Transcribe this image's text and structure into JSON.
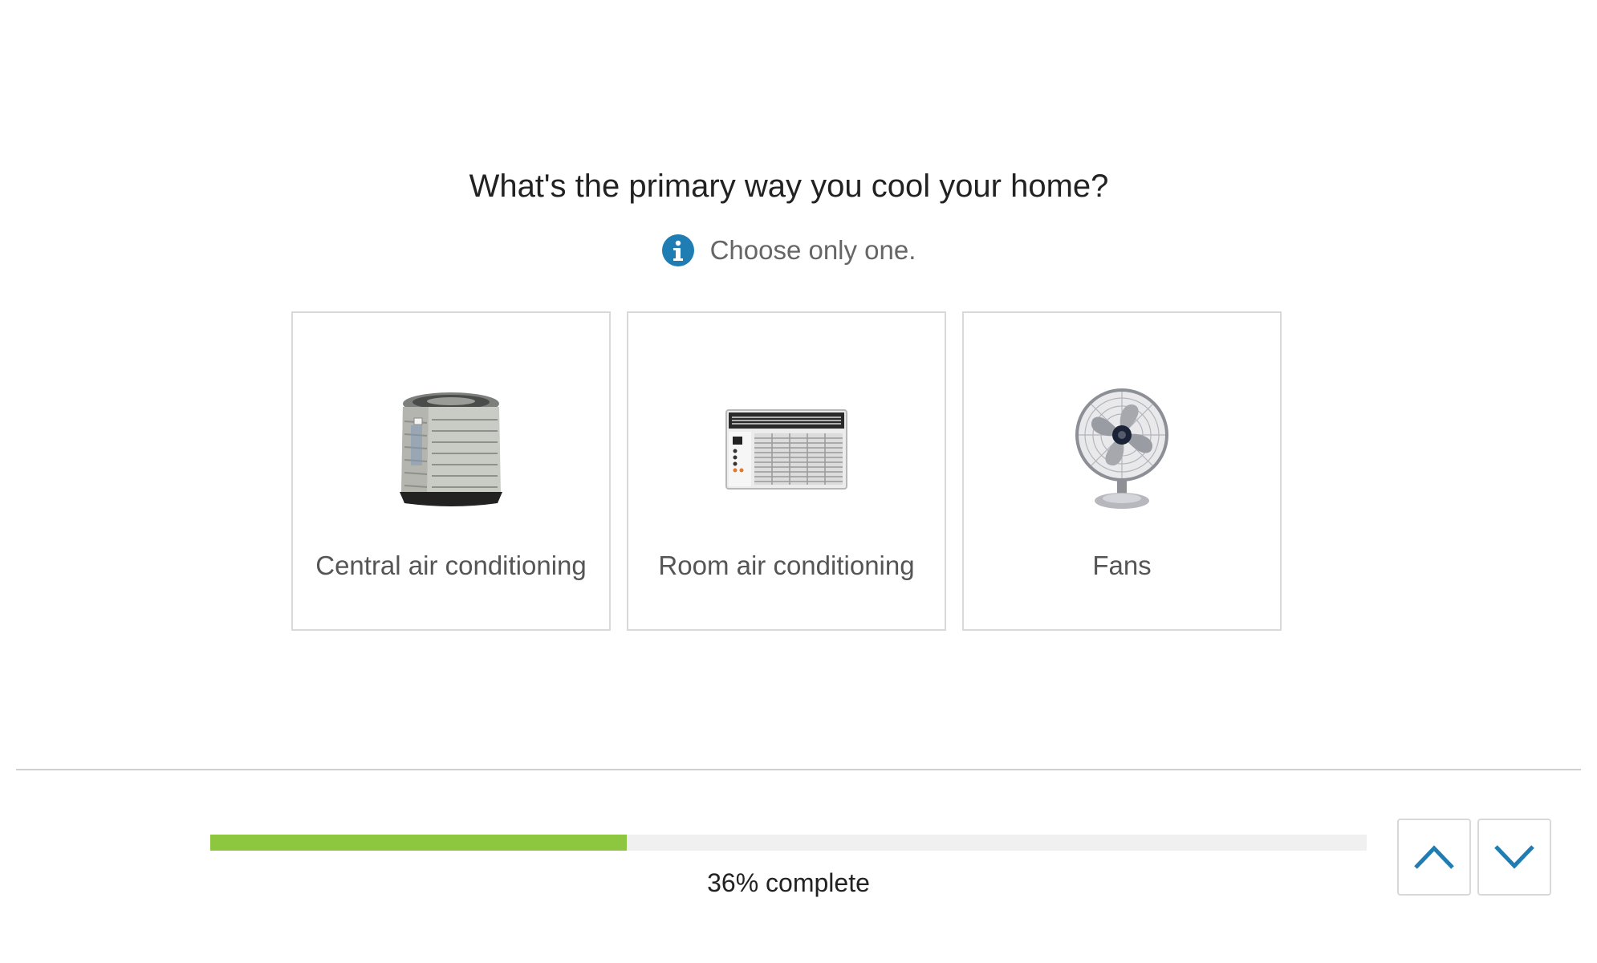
{
  "question": {
    "title": "What's the primary way you cool your home?",
    "hint": "Choose only one.",
    "hint_icon": "info-icon"
  },
  "options": [
    {
      "label": "Central air conditioning",
      "icon": "central-ac-unit-icon"
    },
    {
      "label": "Room air conditioning",
      "icon": "window-ac-unit-icon"
    },
    {
      "label": "Fans",
      "icon": "desk-fan-icon"
    }
  ],
  "progress": {
    "percent": 36,
    "text": "36% complete",
    "fill_color": "#8dc63f",
    "track_color": "#f0f0f0"
  },
  "navigation": {
    "previous_icon": "chevron-up-icon",
    "next_icon": "chevron-down-icon",
    "accent_color": "#1f7db3"
  }
}
